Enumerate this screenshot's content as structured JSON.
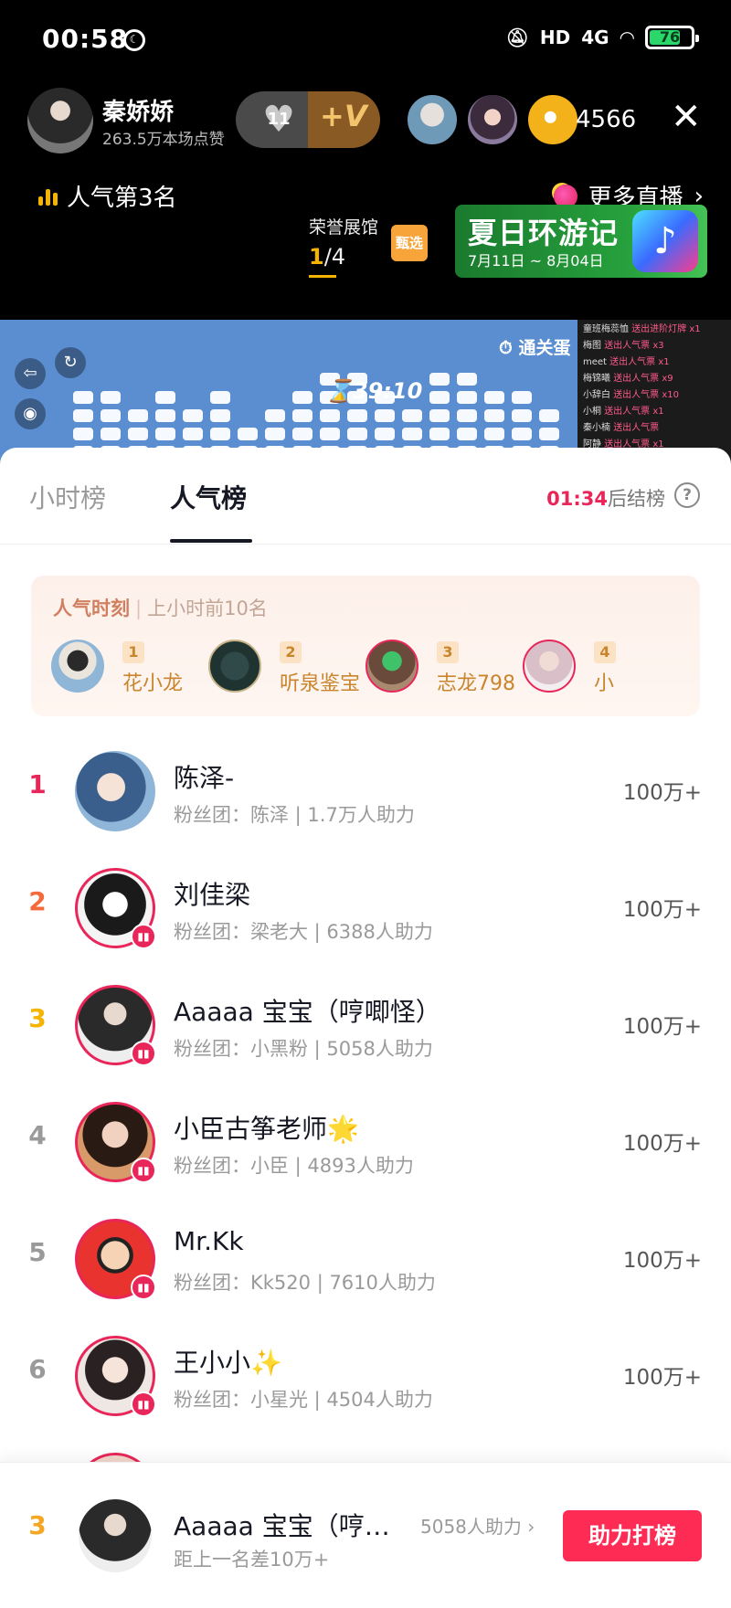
{
  "status_bar": {
    "time": "00:58",
    "moon_glyph": "☾",
    "hd": "HD",
    "net": "4G",
    "battery": "76",
    "battery_level": 0.76
  },
  "live": {
    "host_name": "秦娇娇",
    "host_likes": "263.5万本场点赞",
    "heart_badge": "11",
    "plus_v": "+V",
    "viewer_count": "4566",
    "close_glyph": "✕",
    "rank_text": "人气第3名",
    "more_live": "更多直播",
    "more_arrow": "›",
    "honor_title": "荣誉展馆",
    "honor_page_cur": "1",
    "honor_page_total": "/4",
    "gift_label": "甄选",
    "promo_title": "夏日环游记",
    "promo_dates": "7月11日 ~ 8月04日"
  },
  "game": {
    "timer": "39:10",
    "pass_label": "通关蛋",
    "chat": [
      {
        "user": "童班梅蕊恤",
        "text": "送出进阶灯牌 x1"
      },
      {
        "user": "梅图",
        "text": "送出人气票 x3"
      },
      {
        "user": "meet",
        "text": "送出人气票 x1"
      },
      {
        "user": "梅锦曦",
        "text": "送出人气票 x9"
      },
      {
        "user": "小辞白",
        "text": "送出人气票 x10"
      },
      {
        "user": "小桐",
        "text": "送出人气票 x1"
      },
      {
        "user": "秦小楠",
        "text": "送出人气票"
      },
      {
        "user": "阿静",
        "text": "送出人气票 x1"
      }
    ]
  },
  "tabs": {
    "hourly": "小时榜",
    "popular": "人气榜"
  },
  "countdown": {
    "time": "01:34",
    "suffix": "后结榜",
    "help": "?"
  },
  "moment": {
    "title": "人气时刻",
    "subtitle": "上小时前10名",
    "items": [
      {
        "rank": "1",
        "name": "花小龙"
      },
      {
        "rank": "2",
        "name": "听泉鉴宝"
      },
      {
        "rank": "3",
        "name": "志龙798"
      },
      {
        "rank": "4",
        "name": "小"
      }
    ]
  },
  "ranking": [
    {
      "rank": "1",
      "name": "陈泽-",
      "fans": "粉丝团：陈泽 | 1.7万人助力",
      "score": "100万+"
    },
    {
      "rank": "2",
      "name": "刘佳梁",
      "fans": "粉丝团：梁老大 | 6388人助力",
      "score": "100万+"
    },
    {
      "rank": "3",
      "name": "Aaaaa  宝宝（哼唧怪）",
      "fans": "粉丝团：小黑粉 | 5058人助力",
      "score": "100万+"
    },
    {
      "rank": "4",
      "name": "小臣古筝老师🌟",
      "fans": "粉丝团：小臣 | 4893人助力",
      "score": "100万+"
    },
    {
      "rank": "5",
      "name": "Mr.Kk",
      "fans": "粉丝团：Kk520 | 7610人助力",
      "score": "100万+"
    },
    {
      "rank": "6",
      "name": "王小小✨",
      "fans": "粉丝团：小星光 | 4504人助力",
      "score": "100万+"
    }
  ],
  "rank_colors": [
    "#e8265a",
    "#f56a3a",
    "#f5b400",
    "#9a9a9a",
    "#9a9a9a",
    "#9a9a9a"
  ],
  "footer": {
    "rank": "3",
    "name": "Aaaaa  宝宝（哼…",
    "help": "5058人助力 ›",
    "gap": "距上一名差10万+",
    "button": "助力打榜"
  }
}
